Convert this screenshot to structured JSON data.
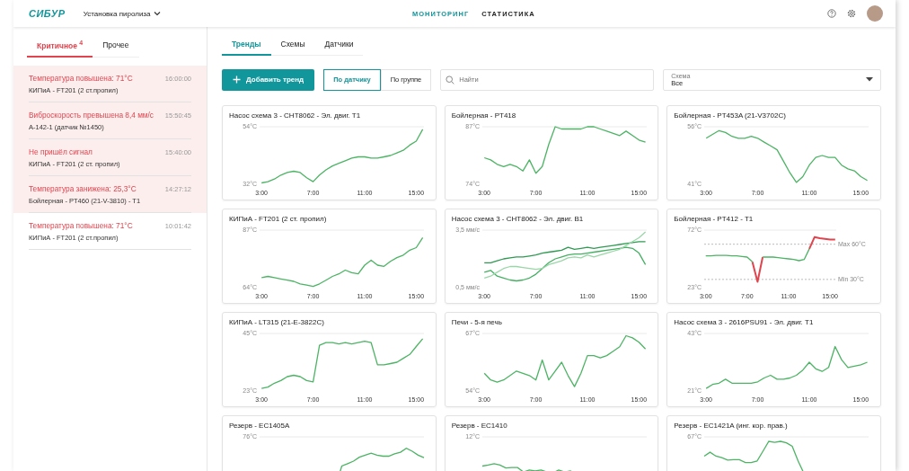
{
  "header": {
    "logo": "СИБУР",
    "plant_selector": "Установка пиролиза",
    "nav": [
      {
        "label": "МОНИТОРИНГ",
        "selected": true
      },
      {
        "label": "СТАТИСТИКА",
        "selected": false
      }
    ]
  },
  "alert_tabs": [
    {
      "label": "Критичное",
      "badge": "4",
      "selected": true
    },
    {
      "label": "Прочее",
      "selected": false
    }
  ],
  "alerts": [
    {
      "title": "Температура повышена: 71°C",
      "time": "16:00:00",
      "source": "КИПиА - FT201 (2 ст.пропил)",
      "highlighted": true
    },
    {
      "title": "Виброскорость превышена 8,4 мм/с",
      "time": "15:50:45",
      "source": "А-142-1 (датчик №1450)",
      "highlighted": true
    },
    {
      "title": "Не пришёл сигнал",
      "time": "15:40:00",
      "source": "КИПиА - FT201 (2 ст. пропил)",
      "highlighted": true
    },
    {
      "title": "Температура занижена: 25,3°C",
      "time": "14:27:12",
      "source": "Бойлерная - PT460 (21-V-3810) - T1",
      "highlighted": true
    },
    {
      "title": "Температура повышена: 71°C",
      "time": "10:01:42",
      "source": "КИПиА - FT201 (2 ст.пропил)",
      "highlighted": false
    }
  ],
  "main_tabs": [
    {
      "label": "Тренды",
      "selected": true
    },
    {
      "label": "Схемы",
      "selected": false
    },
    {
      "label": "Датчики",
      "selected": false
    }
  ],
  "toolbar": {
    "add_button": "Добавить тренд",
    "group_toggle": [
      {
        "label": "По датчику",
        "selected": true
      },
      {
        "label": "По группе",
        "selected": false
      }
    ],
    "search": {
      "placeholder": "Найти"
    },
    "scheme_select": {
      "label": "Схема",
      "value": "Все"
    }
  },
  "cards": [
    {
      "title": "Насос схема 3 - CHT8062 - Эл. двиг. T1",
      "chart_data": {
        "type": "line",
        "x": [
          3,
          3.5,
          4,
          4.5,
          5,
          5.5,
          6,
          6.5,
          7,
          7.5,
          8,
          8.5,
          9,
          9.5,
          10,
          10.5,
          11,
          11.5,
          12,
          12.5,
          13,
          13.5,
          14,
          14.5,
          15,
          15.5
        ],
        "xlim": [
          2.85,
          15.6
        ],
        "series": [
          {
            "color": "#4cb464",
            "values": [
              32.5,
              33,
              34,
              35.5,
              36.5,
              37,
              36.5,
              34.5,
              33,
              35.5,
              37.5,
              39,
              40,
              41,
              42,
              42.5,
              42.5,
              42,
              42,
              42.5,
              43,
              44,
              45,
              47,
              48.5,
              53
            ]
          }
        ],
        "ylim": [
          32,
          54
        ],
        "yticks": [
          {
            "value": 32,
            "label": "32°C"
          },
          {
            "value": 54,
            "label": "54°C"
          }
        ],
        "xticks": [
          {
            "value": 3,
            "label": "3:00"
          },
          {
            "value": 7,
            "label": "7:00"
          },
          {
            "value": 11,
            "label": "11:00"
          },
          {
            "value": 15,
            "label": "15:00"
          }
        ]
      }
    },
    {
      "title": "Бойлерная - PT418",
      "chart_data": {
        "type": "line",
        "x": [
          3,
          3.5,
          4,
          4.5,
          5,
          5.5,
          6,
          6.5,
          7,
          7.5,
          8,
          8.5,
          9,
          9.5,
          10,
          10.5,
          11,
          11.5,
          12,
          12.5,
          13,
          13.5,
          14,
          14.5,
          15,
          15.5
        ],
        "xlim": [
          2.85,
          15.6
        ],
        "series": [
          {
            "color": "#4cb464",
            "values": [
              80,
              79.5,
              78.5,
              78,
              78.5,
              78,
              77,
              79.5,
              76.5,
              78,
              83,
              87,
              86.5,
              86.5,
              86.5,
              86.5,
              87,
              87,
              86.5,
              86,
              85.5,
              85,
              86,
              85,
              84,
              83.5
            ]
          }
        ],
        "ylim": [
          74,
          87
        ],
        "yticks": [
          {
            "value": 74,
            "label": "74°C"
          },
          {
            "value": 87,
            "label": "87°C"
          }
        ],
        "xticks": [
          {
            "value": 3,
            "label": "3:00"
          },
          {
            "value": 7,
            "label": "7:00"
          },
          {
            "value": 11,
            "label": "11:00"
          },
          {
            "value": 15,
            "label": "15:00"
          }
        ]
      }
    },
    {
      "title": "Бойлерная - PT453A (21-V3702C)",
      "chart_data": {
        "type": "line",
        "x": [
          3,
          3.5,
          4,
          4.5,
          5,
          5.5,
          6,
          6.5,
          7,
          7.5,
          8,
          8.5,
          9,
          9.5,
          10,
          10.5,
          11,
          11.5,
          12,
          12.5,
          13,
          13.5,
          14,
          14.5,
          15,
          15.5
        ],
        "xlim": [
          2.85,
          15.6
        ],
        "series": [
          {
            "color": "#4cb464",
            "values": [
              53,
              54,
              55,
              54.5,
              53.5,
              53,
              53,
              53.5,
              53,
              52,
              51,
              50,
              47,
              44,
              41.5,
              43,
              46,
              48,
              48.5,
              48,
              48,
              46,
              45,
              44.5,
              43,
              42
            ]
          }
        ],
        "ylim": [
          41,
          56
        ],
        "yticks": [
          {
            "value": 41,
            "label": "41°C"
          },
          {
            "value": 56,
            "label": "56°C"
          }
        ],
        "xticks": [
          {
            "value": 3,
            "label": "3:00"
          },
          {
            "value": 7,
            "label": "7:00"
          },
          {
            "value": 11,
            "label": "11:00"
          },
          {
            "value": 15,
            "label": "15:00"
          }
        ]
      }
    },
    {
      "title": "КИПиА - FT201 (2 ст. пропил)",
      "chart_data": {
        "type": "line",
        "x": [
          3,
          3.5,
          4,
          4.5,
          5,
          5.5,
          6,
          6.5,
          7,
          7.5,
          8,
          8.5,
          9,
          9.5,
          10,
          10.5,
          11,
          11.5,
          12,
          12.5,
          13,
          13.5,
          14,
          14.5,
          15,
          15.5
        ],
        "xlim": [
          2.85,
          15.6
        ],
        "series": [
          {
            "color": "#4cb464",
            "values": [
              68,
              68.5,
              68,
              67.5,
              67,
              66.5,
              65.5,
              65,
              64.5,
              65.5,
              67,
              68.5,
              69.5,
              71,
              70,
              69.5,
              73,
              75,
              73,
              72.5,
              74.5,
              76,
              77,
              79,
              80,
              84
            ]
          }
        ],
        "ylim": [
          64,
          87
        ],
        "yticks": [
          {
            "value": 64,
            "label": "64°C"
          },
          {
            "value": 87,
            "label": "87°C"
          }
        ],
        "xticks": [
          {
            "value": 3,
            "label": "3:00"
          },
          {
            "value": 7,
            "label": "7:00"
          },
          {
            "value": 11,
            "label": "11:00"
          },
          {
            "value": 15,
            "label": "15:00"
          }
        ]
      }
    },
    {
      "title": "Насос схема 3 - CHT8062 - Эл. двиг. B1",
      "chart_data": {
        "type": "line",
        "x": [
          3,
          3.5,
          4,
          4.5,
          5,
          5.5,
          6,
          6.5,
          7,
          7.5,
          8,
          8.5,
          9,
          9.5,
          10,
          10.5,
          11,
          11.5,
          12,
          12.5,
          13,
          13.5,
          14,
          14.5,
          15,
          15.5
        ],
        "xlim": [
          2.85,
          15.6
        ],
        "series": [
          {
            "color": "#2f9a52",
            "values": [
              1.8,
              1.8,
              1.9,
              2.0,
              2.05,
              2.1,
              2.1,
              2.15,
              2.2,
              2.3,
              2.35,
              2.4,
              2.45,
              2.6,
              2.5,
              2.55,
              2.6,
              2.55,
              2.6,
              2.65,
              2.7,
              2.75,
              2.8,
              2.85,
              2.9,
              2.9
            ]
          },
          {
            "color": "#45b062",
            "values": [
              1.3,
              1.4,
              1.1,
              1.0,
              0.9,
              0.85,
              0.9,
              1.0,
              1.2,
              1.5,
              1.8,
              2.0,
              2.1,
              2.2,
              2.25,
              2.25,
              2.3,
              2.35,
              2.4,
              2.45,
              2.5,
              2.55,
              2.6,
              2.55,
              2.3,
              1.7
            ]
          },
          {
            "color": "#9ad6a8",
            "values": [
              1.0,
              1.1,
              1.3,
              1.5,
              1.6,
              1.6,
              1.55,
              1.5,
              1.45,
              1.5,
              1.7,
              1.8,
              1.9,
              2.05,
              2.1,
              2.05,
              2.2,
              2.1,
              2.2,
              2.3,
              2.4,
              2.5,
              2.7,
              2.9,
              3.1,
              3.4
            ]
          }
        ],
        "ylim": [
          0.5,
          3.5
        ],
        "yticks": [
          {
            "value": 0.5,
            "label": "0,5 мм/с"
          },
          {
            "value": 3.5,
            "label": "3,5 мм/с"
          }
        ],
        "xticks": [
          {
            "value": 3,
            "label": "3:00"
          },
          {
            "value": 7,
            "label": "7:00"
          },
          {
            "value": 11,
            "label": "11:00"
          },
          {
            "value": 15,
            "label": "15:00"
          }
        ]
      }
    },
    {
      "title": "Бойлерная - PT412 - T1",
      "chart_data": {
        "type": "line",
        "x": [
          3,
          3.5,
          4,
          4.5,
          5,
          5.5,
          6,
          6.5,
          7,
          7.5,
          8,
          8.5,
          9,
          9.5,
          10,
          10.5,
          11,
          11.5,
          12,
          12.5,
          13,
          13.5,
          14,
          14.5,
          15,
          15.5
        ],
        "xlim": [
          2.85,
          15.6
        ],
        "series": [
          {
            "color": "#e0444e",
            "values": [
              null,
              null,
              null,
              null,
              null,
              null,
              null,
              null,
              null,
              45,
              28,
              49,
              null,
              null,
              null,
              null,
              null,
              null,
              null,
              null,
              56,
              66,
              65,
              64.5,
              64,
              64
            ]
          },
          {
            "color": "#4cb464",
            "values": [
              50,
              50,
              50.5,
              50.5,
              50.5,
              50,
              50,
              49.5,
              49,
              45,
              null,
              49,
              49,
              49,
              48.5,
              48,
              47.5,
              47,
              46,
              47,
              56,
              null,
              null,
              null,
              null,
              null
            ]
          }
        ],
        "ylim": [
          23,
          72
        ],
        "yticks": [
          {
            "value": 23,
            "label": "23°C"
          },
          {
            "value": 72,
            "label": "72°C"
          }
        ],
        "xticks": [
          {
            "value": 3,
            "label": "3:00"
          },
          {
            "value": 7,
            "label": "7:00"
          },
          {
            "value": 11,
            "label": "11:00"
          },
          {
            "value": 15,
            "label": "15:00"
          }
        ],
        "ref_lines": [
          {
            "axis": "y",
            "value": 60,
            "label": "Max 60°C"
          },
          {
            "axis": "y",
            "value": 30,
            "label": "Min 30°C"
          }
        ]
      }
    },
    {
      "title": "КИПиА - LT315 (21-E-3822C)",
      "chart_data": {
        "type": "line",
        "x": [
          3,
          3.5,
          4,
          4.5,
          5,
          5.5,
          6,
          6.5,
          7,
          7.5,
          8,
          8.5,
          9,
          9.5,
          10,
          10.5,
          11,
          11.5,
          12,
          12.5,
          13,
          13.5,
          14,
          14.5,
          15,
          15.5
        ],
        "xlim": [
          2.85,
          15.6
        ],
        "series": [
          {
            "color": "#4cb464",
            "values": [
              24,
              24.5,
              26,
              27,
              28.5,
              29,
              28.5,
              27,
              26.5,
              40.5,
              41.5,
              41.5,
              41,
              41.5,
              41,
              41.5,
              42,
              41.5,
              33,
              33,
              33.5,
              34,
              35.5,
              37,
              40,
              43
            ]
          }
        ],
        "ylim": [
          23,
          45
        ],
        "yticks": [
          {
            "value": 23,
            "label": "23°C"
          },
          {
            "value": 45,
            "label": "45°C"
          }
        ],
        "xticks": [
          {
            "value": 3,
            "label": "3:00"
          },
          {
            "value": 7,
            "label": "7:00"
          },
          {
            "value": 11,
            "label": "11:00"
          },
          {
            "value": 15,
            "label": "15:00"
          }
        ]
      }
    },
    {
      "title": "Печи - 5-я печь",
      "chart_data": {
        "type": "line",
        "x": [
          3,
          3.5,
          4,
          4.5,
          5,
          5.5,
          6,
          6.5,
          7,
          7.5,
          8,
          8.5,
          9,
          9.5,
          10,
          10.5,
          11,
          11.5,
          12,
          12.5,
          13,
          13.5,
          14,
          14.5,
          15,
          15.5
        ],
        "xlim": [
          2.85,
          15.6
        ],
        "series": [
          {
            "color": "#4cb464",
            "values": [
              58,
              56.5,
              56,
              56.5,
              57.5,
              58.5,
              58,
              57.5,
              56.5,
              61,
              56.5,
              58.5,
              60.5,
              57.5,
              55,
              58,
              62,
              62,
              61.5,
              62,
              63,
              64,
              66.5,
              66,
              65,
              63.5
            ]
          }
        ],
        "ylim": [
          54,
          67
        ],
        "yticks": [
          {
            "value": 54,
            "label": "54°C"
          },
          {
            "value": 67,
            "label": "67°C"
          }
        ],
        "xticks": [
          {
            "value": 3,
            "label": "3:00"
          },
          {
            "value": 7,
            "label": "7:00"
          },
          {
            "value": 11,
            "label": "11:00"
          },
          {
            "value": 15,
            "label": "15:00"
          }
        ]
      }
    },
    {
      "title": "Насос схема 3 - 2616PSU91 - Эл. двиг. T1",
      "chart_data": {
        "type": "line",
        "x": [
          3,
          3.5,
          4,
          4.5,
          5,
          5.5,
          6,
          6.5,
          7,
          7.5,
          8,
          8.5,
          9,
          9.5,
          10,
          10.5,
          11,
          11.5,
          12,
          12.5,
          13,
          13.5,
          14,
          14.5,
          15,
          15.5
        ],
        "xlim": [
          2.85,
          15.6
        ],
        "series": [
          {
            "color": "#4cb464",
            "values": [
              22,
              23.5,
              24,
              25.5,
              24,
              24,
              24,
              24,
              24.5,
              26,
              27,
              25.5,
              25.5,
              26,
              27,
              29,
              32,
              29.5,
              28.5,
              30,
              38,
              33,
              30,
              30.5,
              31,
              32
            ]
          }
        ],
        "ylim": [
          21,
          43
        ],
        "yticks": [
          {
            "value": 21,
            "label": "21°C"
          },
          {
            "value": 43,
            "label": "43°C"
          }
        ],
        "xticks": [
          {
            "value": 3,
            "label": "3:00"
          },
          {
            "value": 7,
            "label": "7:00"
          },
          {
            "value": 11,
            "label": "11:00"
          },
          {
            "value": 15,
            "label": "15:00"
          }
        ]
      }
    },
    {
      "title": "Резерв - EC1405A",
      "top_label": "76°C"
    },
    {
      "title": "Резерв - EC1410",
      "top_label": "12°C"
    },
    {
      "title": "Резерв - EC1421A (инг. кор. прав.)",
      "top_label": "67°C"
    }
  ]
}
